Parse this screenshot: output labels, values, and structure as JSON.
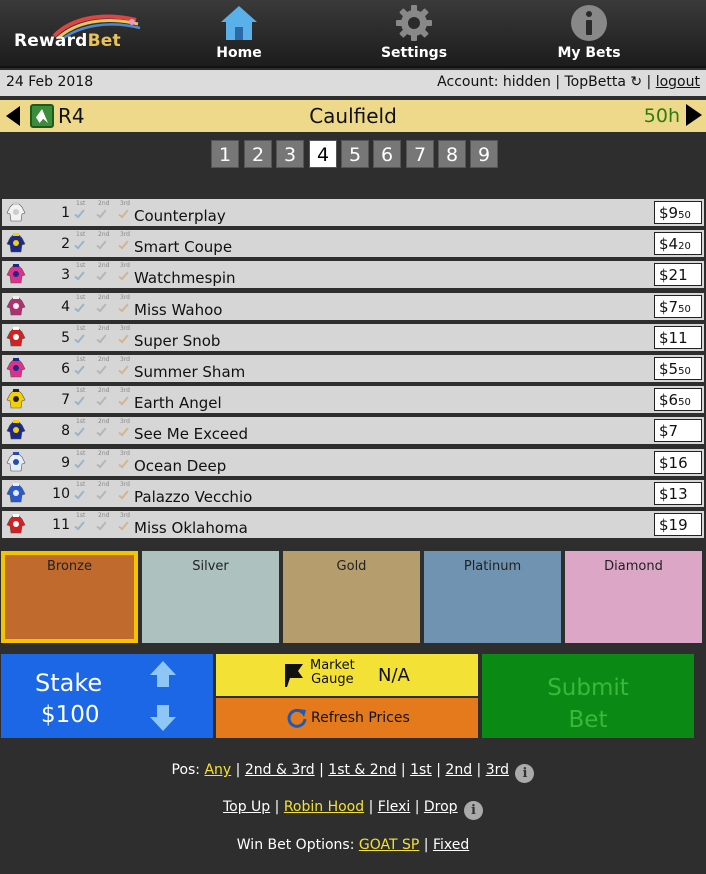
{
  "nav": {
    "logo_reward": "Reward",
    "logo_bet": "Bet",
    "items": [
      {
        "label": "Home",
        "icon": "home-icon"
      },
      {
        "label": "Settings",
        "icon": "gear-icon"
      },
      {
        "label": "My Bets",
        "icon": "info-icon"
      }
    ]
  },
  "account": {
    "date": "24 Feb 2018",
    "account_text": "Account: hidden | TopBetta",
    "logout": "logout"
  },
  "race": {
    "number": "R4",
    "venue": "Caulfield",
    "time_to_jump": "50h",
    "selectors": [
      "1",
      "2",
      "3",
      "4",
      "5",
      "6",
      "7",
      "8",
      "9"
    ],
    "selected": "4"
  },
  "checks": {
    "first": "1st",
    "second": "2nd",
    "third": "3rd"
  },
  "runners": [
    {
      "num": "1",
      "name": "Counterplay",
      "price_main": "$9",
      "price_cents": "50",
      "silk": [
        "#f2f2f2",
        "#cccccc"
      ]
    },
    {
      "num": "2",
      "name": "Smart Coupe",
      "price_main": "$4",
      "price_cents": "20",
      "silk": [
        "#1b2a8a",
        "#f5d000"
      ]
    },
    {
      "num": "3",
      "name": "Watchmespin",
      "price_main": "$21",
      "price_cents": "",
      "silk": [
        "#e0318a",
        "#1b2a8a"
      ]
    },
    {
      "num": "4",
      "name": "Miss Wahoo",
      "price_main": "$7",
      "price_cents": "50",
      "silk": [
        "#b03070",
        "#f2f2f2"
      ]
    },
    {
      "num": "5",
      "name": "Super Snob",
      "price_main": "$11",
      "price_cents": "",
      "silk": [
        "#d42020",
        "#ffffff"
      ]
    },
    {
      "num": "6",
      "name": "Summer Sham",
      "price_main": "$5",
      "price_cents": "50",
      "silk": [
        "#e0318a",
        "#1b2a8a"
      ]
    },
    {
      "num": "7",
      "name": "Earth Angel",
      "price_main": "$6",
      "price_cents": "50",
      "silk": [
        "#f5d000",
        "#222222"
      ]
    },
    {
      "num": "8",
      "name": "See Me Exceed",
      "price_main": "$7",
      "price_cents": "",
      "silk": [
        "#1b2a8a",
        "#f5d000"
      ]
    },
    {
      "num": "9",
      "name": "Ocean Deep",
      "price_main": "$16",
      "price_cents": "",
      "silk": [
        "#e8eef8",
        "#2a4ab0"
      ]
    },
    {
      "num": "10",
      "name": "Palazzo Vecchio",
      "price_main": "$13",
      "price_cents": "",
      "silk": [
        "#2a5ad0",
        "#e8eef8"
      ]
    },
    {
      "num": "11",
      "name": "Miss Oklahoma",
      "price_main": "$19",
      "price_cents": "",
      "silk": [
        "#d42020",
        "#ffffff"
      ]
    }
  ],
  "tiers": [
    {
      "label": "Bronze",
      "color": "#c06a2e",
      "selected": true
    },
    {
      "label": "Silver",
      "color": "#adc1be",
      "selected": false
    },
    {
      "label": "Gold",
      "color": "#b59d6e",
      "selected": false
    },
    {
      "label": "Platinum",
      "color": "#6f93b0",
      "selected": false
    },
    {
      "label": "Diamond",
      "color": "#dca6c6",
      "selected": false
    }
  ],
  "stake": {
    "label": "Stake",
    "value": "$100"
  },
  "gauge": {
    "label_line1": "Market",
    "label_line2": "Gauge",
    "value": "N/A"
  },
  "refresh": {
    "label": "Refresh Prices"
  },
  "submit": {
    "line1": "Submit",
    "line2": "Bet"
  },
  "pos_options": {
    "prefix": "Pos:",
    "options": [
      "Any",
      "2nd & 3rd",
      "1st & 2nd",
      "1st",
      "2nd",
      "3rd"
    ]
  },
  "bet_types": {
    "options": [
      "Top Up",
      "Robin Hood",
      "Flexi",
      "Drop"
    ]
  },
  "win_options": {
    "prefix": "Win Bet Options:",
    "options": [
      "GOAT SP",
      "Fixed"
    ]
  },
  "colors": {
    "accent_yellow": "#f3e135",
    "stake_blue": "#1b67e6",
    "submit_green": "#0a8a14",
    "refresh_orange": "#e47a1c",
    "race_bar": "#eed98a",
    "time_green": "#2f7d10"
  }
}
